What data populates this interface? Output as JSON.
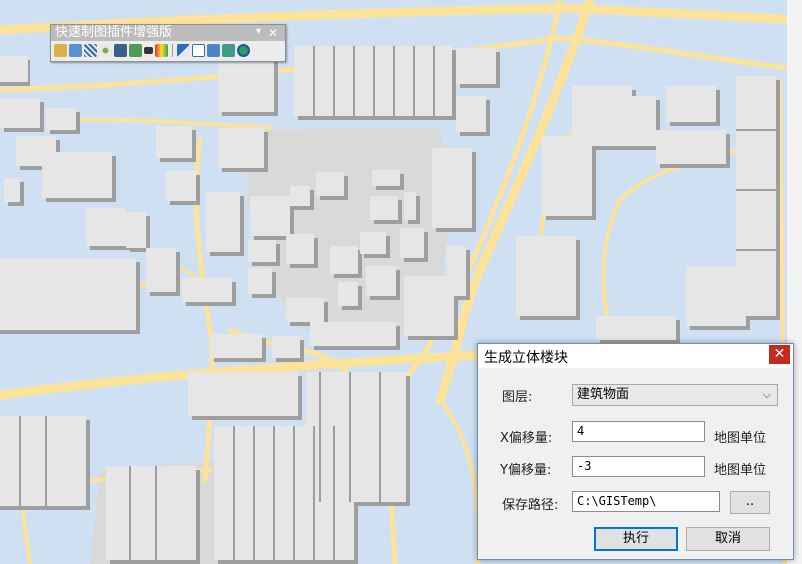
{
  "toolbar": {
    "title": "快速制图插件增强版",
    "pin_glyph": "▾",
    "close_glyph": "✕",
    "icons": [
      "route-icon",
      "globe-icon",
      "hatch-icon",
      "scatter-icon",
      "table-icon",
      "network-icon",
      "rect-icon",
      "palette-icon",
      "separator",
      "arrow-icon",
      "frame-icon",
      "image-icon",
      "layers-icon",
      "sphere-icon"
    ]
  },
  "dialog": {
    "title": "生成立体楼块",
    "close_glyph": "✕",
    "layer_label": "图层:",
    "layer_value": "建筑物面",
    "x_label": "X偏移量:",
    "x_value": "4",
    "x_unit": "地图单位",
    "y_label": "Y偏移量:",
    "y_value": "-3",
    "y_unit": "地图单位",
    "path_label": "保存路径:",
    "path_value": "C:\\GISTemp\\",
    "browse_label": "..",
    "ok_label": "执行",
    "cancel_label": "取消"
  },
  "colors": {
    "water": "#cfe0f3",
    "road": "#fde29a",
    "building_top": "#e6e6e6",
    "building_side": "#9e9e9e",
    "plaza": "#d9d9d9",
    "close_red": "#c42b1c"
  }
}
